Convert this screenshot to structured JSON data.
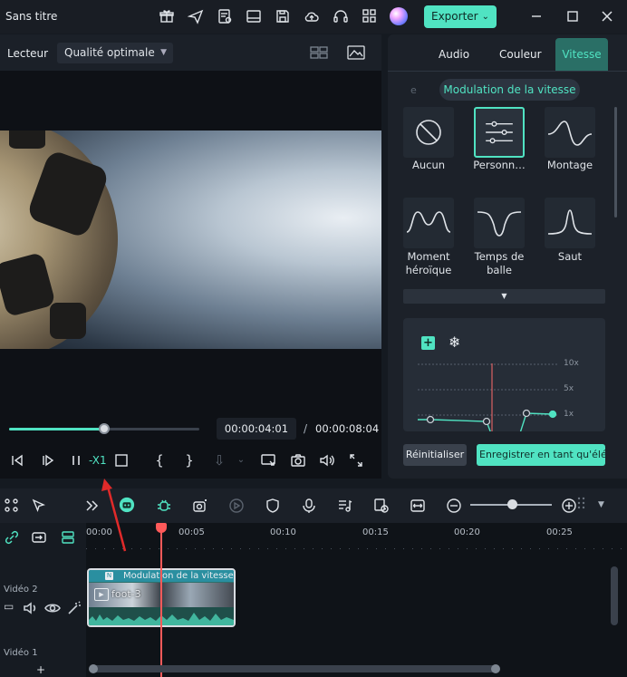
{
  "app": {
    "title": "Sans titre",
    "export_label": "Exporter"
  },
  "player": {
    "label": "Lecteur",
    "quality": "Qualité optimale",
    "current_time": "00:00:04:01",
    "separator": "/",
    "total_time": "00:00:08:04",
    "progress": 0.5,
    "speed_label": "-X1"
  },
  "panel": {
    "tabs": [
      "Audio",
      "Couleur",
      "Vitesse"
    ],
    "active_tab": "Vitesse",
    "subtab_prev": "e",
    "subtab": "Modulation de la vitesse",
    "presets": [
      {
        "label": "Aucun"
      },
      {
        "label": "Personn…"
      },
      {
        "label": "Montage"
      },
      {
        "label": "Moment héroïque"
      },
      {
        "label": "Temps de balle"
      },
      {
        "label": "Saut"
      }
    ],
    "graph": {
      "labels": [
        "10x",
        "5x",
        "1x"
      ],
      "add_symbol": "+",
      "freeze_symbol": "❄"
    },
    "reset_label": "Réinitialiser",
    "save_label": "Enregistrer en tant qu'élé…"
  },
  "timeline": {
    "ruler": [
      "00:00",
      "00:05",
      "00:10",
      "00:15",
      "00:20",
      "00:25"
    ],
    "tracks": [
      {
        "name": "Vidéo 2"
      },
      {
        "name": "Vidéo 1"
      }
    ],
    "clip": {
      "effect_label": "Modulation de la vitesse",
      "name": "foot-3",
      "badge": "N"
    },
    "add_track": "+"
  },
  "colors": {
    "accent": "#50e3c2",
    "playhead": "#ff5a5a",
    "background": "#151a21"
  }
}
